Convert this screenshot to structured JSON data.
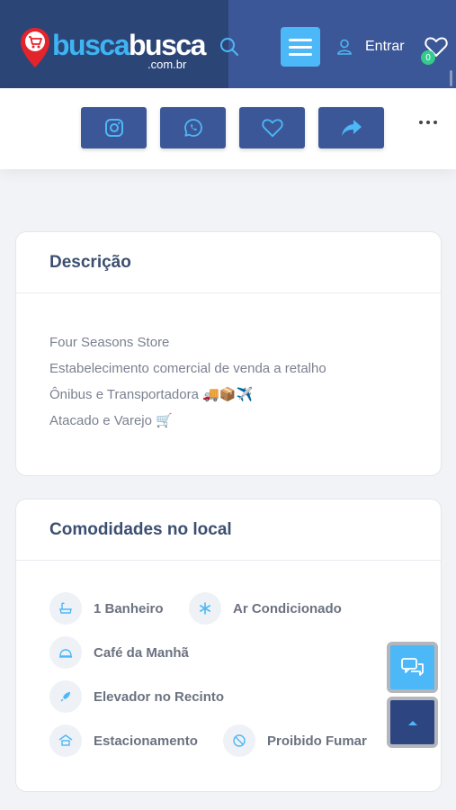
{
  "header": {
    "logo": {
      "part1": "busca",
      "part2": "busca",
      "domain": ".com.br"
    },
    "login_label": "Entrar",
    "favorites_count": "0",
    "icons": [
      "search-icon",
      "menu-icon",
      "user-icon",
      "heart-icon"
    ]
  },
  "share_bar": {
    "buttons": [
      "instagram-icon",
      "whatsapp-icon",
      "heart-icon",
      "share-arrow-icon"
    ],
    "more": "more-dots-icon"
  },
  "description": {
    "title": "Descrição",
    "lines": [
      "Four Seasons Store",
      "Estabelecimento comercial de venda a retalho",
      "Ônibus e Transportadora 🚚📦✈️",
      "Atacado e Varejo 🛒"
    ]
  },
  "amenities": {
    "title": "Comodidades no local",
    "items": [
      {
        "label": "1 Banheiro",
        "icon": "bathtub-icon"
      },
      {
        "label": "Ar Condicionado",
        "icon": "snowflake-icon"
      },
      {
        "label": "Café da Manhã",
        "icon": "cloche-icon"
      },
      {
        "label": "Elevador no Recinto",
        "icon": "rocket-icon"
      },
      {
        "label": "Estacionamento",
        "icon": "garage-icon"
      },
      {
        "label": "Proibido Fumar",
        "icon": "no-smoking-icon"
      }
    ]
  },
  "floating": {
    "chat": "chat-icon",
    "top": "arrow-up-icon"
  },
  "colors": {
    "header_dark": "#2c4577",
    "header_light": "#3c5797",
    "accent": "#4cb8f7",
    "badge": "#35c98e",
    "card_title": "#3b4f70"
  }
}
